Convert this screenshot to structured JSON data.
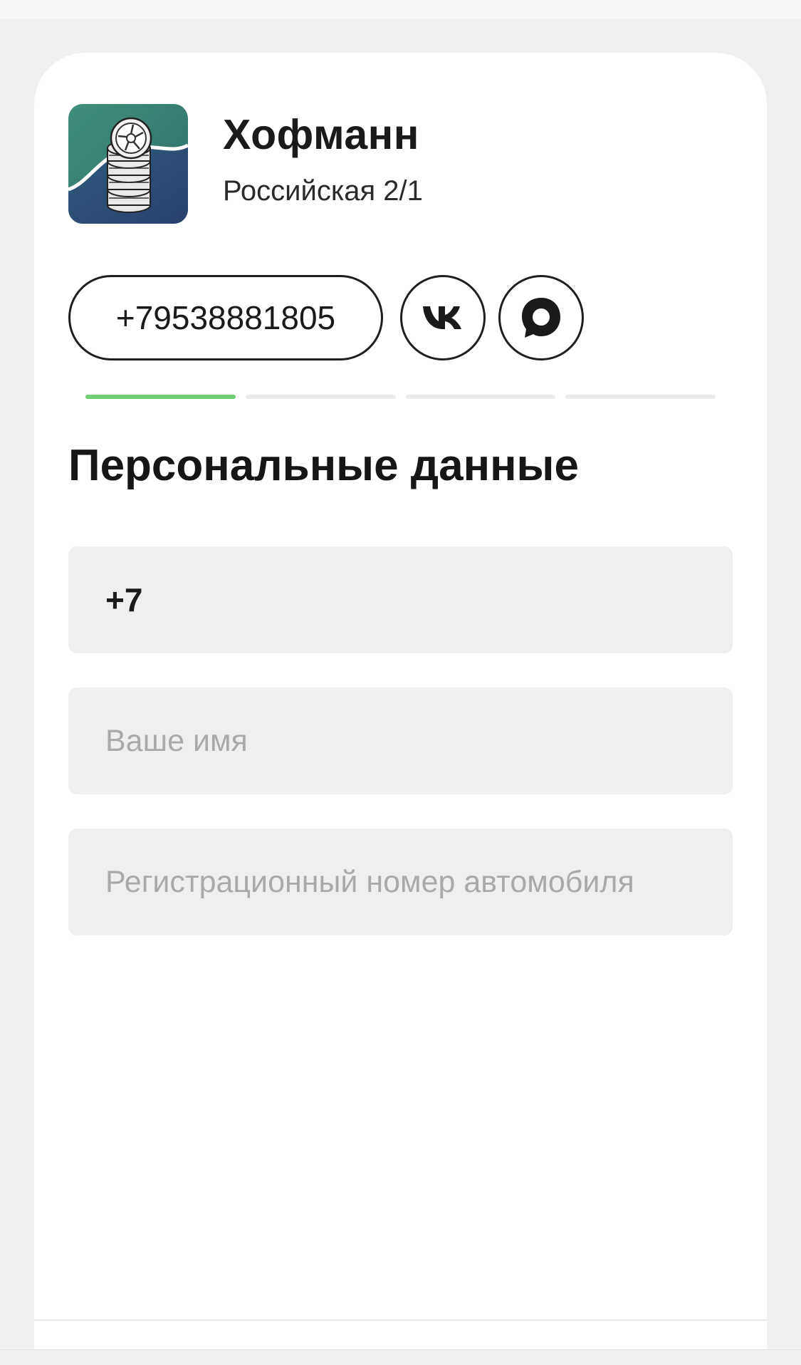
{
  "shop": {
    "name": "Хофманн",
    "address": "Российская 2/1",
    "logo_icon": "tire-stack-icon"
  },
  "contacts": {
    "phone": "+79538881805",
    "vk_icon": "vk-icon",
    "chat_icon": "chat-bubble-icon"
  },
  "progress": {
    "total_steps": 4,
    "current_step": 1,
    "active_color": "#6fcf73"
  },
  "section": {
    "title": "Персональные данные"
  },
  "form": {
    "phone_value": "+7",
    "name_placeholder": "Ваше имя",
    "plate_placeholder": "Регистрационный номер автомобиля"
  }
}
